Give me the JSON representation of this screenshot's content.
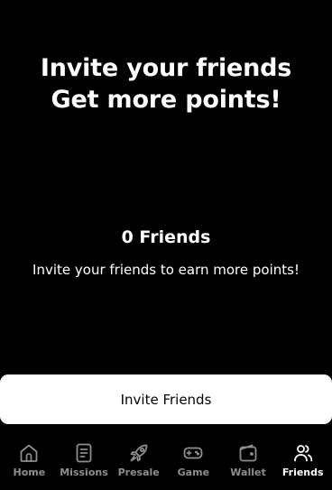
{
  "header": {
    "line1": "Invite your friends",
    "line2": "Get more points!"
  },
  "friends": {
    "count_label": "0 Friends",
    "subtitle": "Invite your friends to earn more points!"
  },
  "invite_button": {
    "label": "Invite Friends"
  },
  "nav": {
    "items": [
      {
        "label": "Home",
        "icon": "home-icon"
      },
      {
        "label": "Missions",
        "icon": "document-icon"
      },
      {
        "label": "Presale",
        "icon": "rocket-icon"
      },
      {
        "label": "Game",
        "icon": "gamepad-icon"
      },
      {
        "label": "Wallet",
        "icon": "wallet-icon"
      },
      {
        "label": "Friends",
        "icon": "users-icon"
      }
    ],
    "active": "Friends"
  },
  "colors": {
    "background": "#000000",
    "text": "#ffffff",
    "nav_inactive": "#8e8e8e",
    "button_bg": "#ffffff",
    "button_text": "#000000"
  }
}
